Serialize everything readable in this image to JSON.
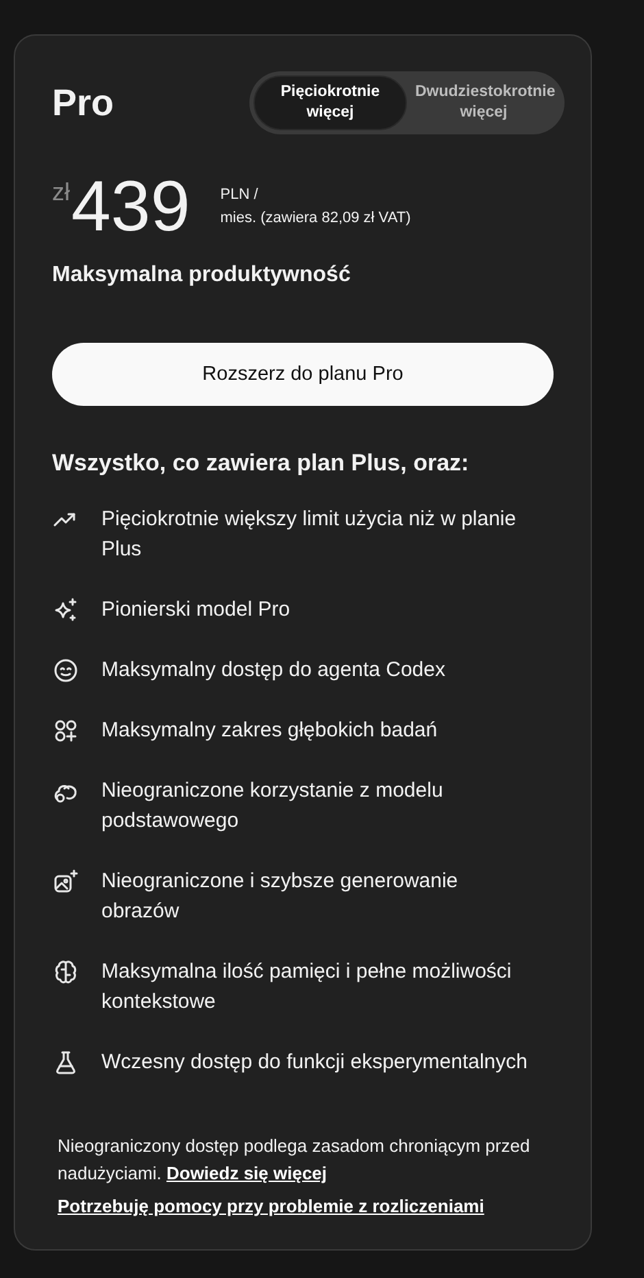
{
  "plan": {
    "name": "Pro",
    "options": [
      {
        "label": "Pięciokrotnie więcej",
        "selected": true
      },
      {
        "label": "Dwudziestokrotnie więcej",
        "selected": false
      }
    ],
    "currency": "zł",
    "price": "439",
    "period": [
      "PLN /",
      "mies. (zawiera 82,09 zł VAT)"
    ],
    "tagline": "Maksymalna produktywność",
    "button": "Rozszerz do planu Pro"
  },
  "features_heading": "Wszystko, co zawiera plan Plus, oraz:",
  "features": [
    "Pięciokrotnie większy limit użycia niż w planie Plus",
    "Pionierski model Pro",
    "Maksymalny dostęp do agenta Codex",
    "Maksymalny zakres głębokich badań",
    "Nieograniczone korzystanie z modelu podstawowego",
    "Nieograniczone i szybsze generowanie obrazów",
    "Maksymalna ilość pamięci i pełne możliwości kontekstowe",
    "Wczesny dostęp do funkcji eksperymentalnych"
  ],
  "footer": {
    "note": "Nieograniczony dostęp podlega zasadom chroniącym przed nadużyciami.",
    "link": "Dowiedz się więcej",
    "help_link": "Potrzebuję pomocy przy problemie z rozliczeniami"
  }
}
